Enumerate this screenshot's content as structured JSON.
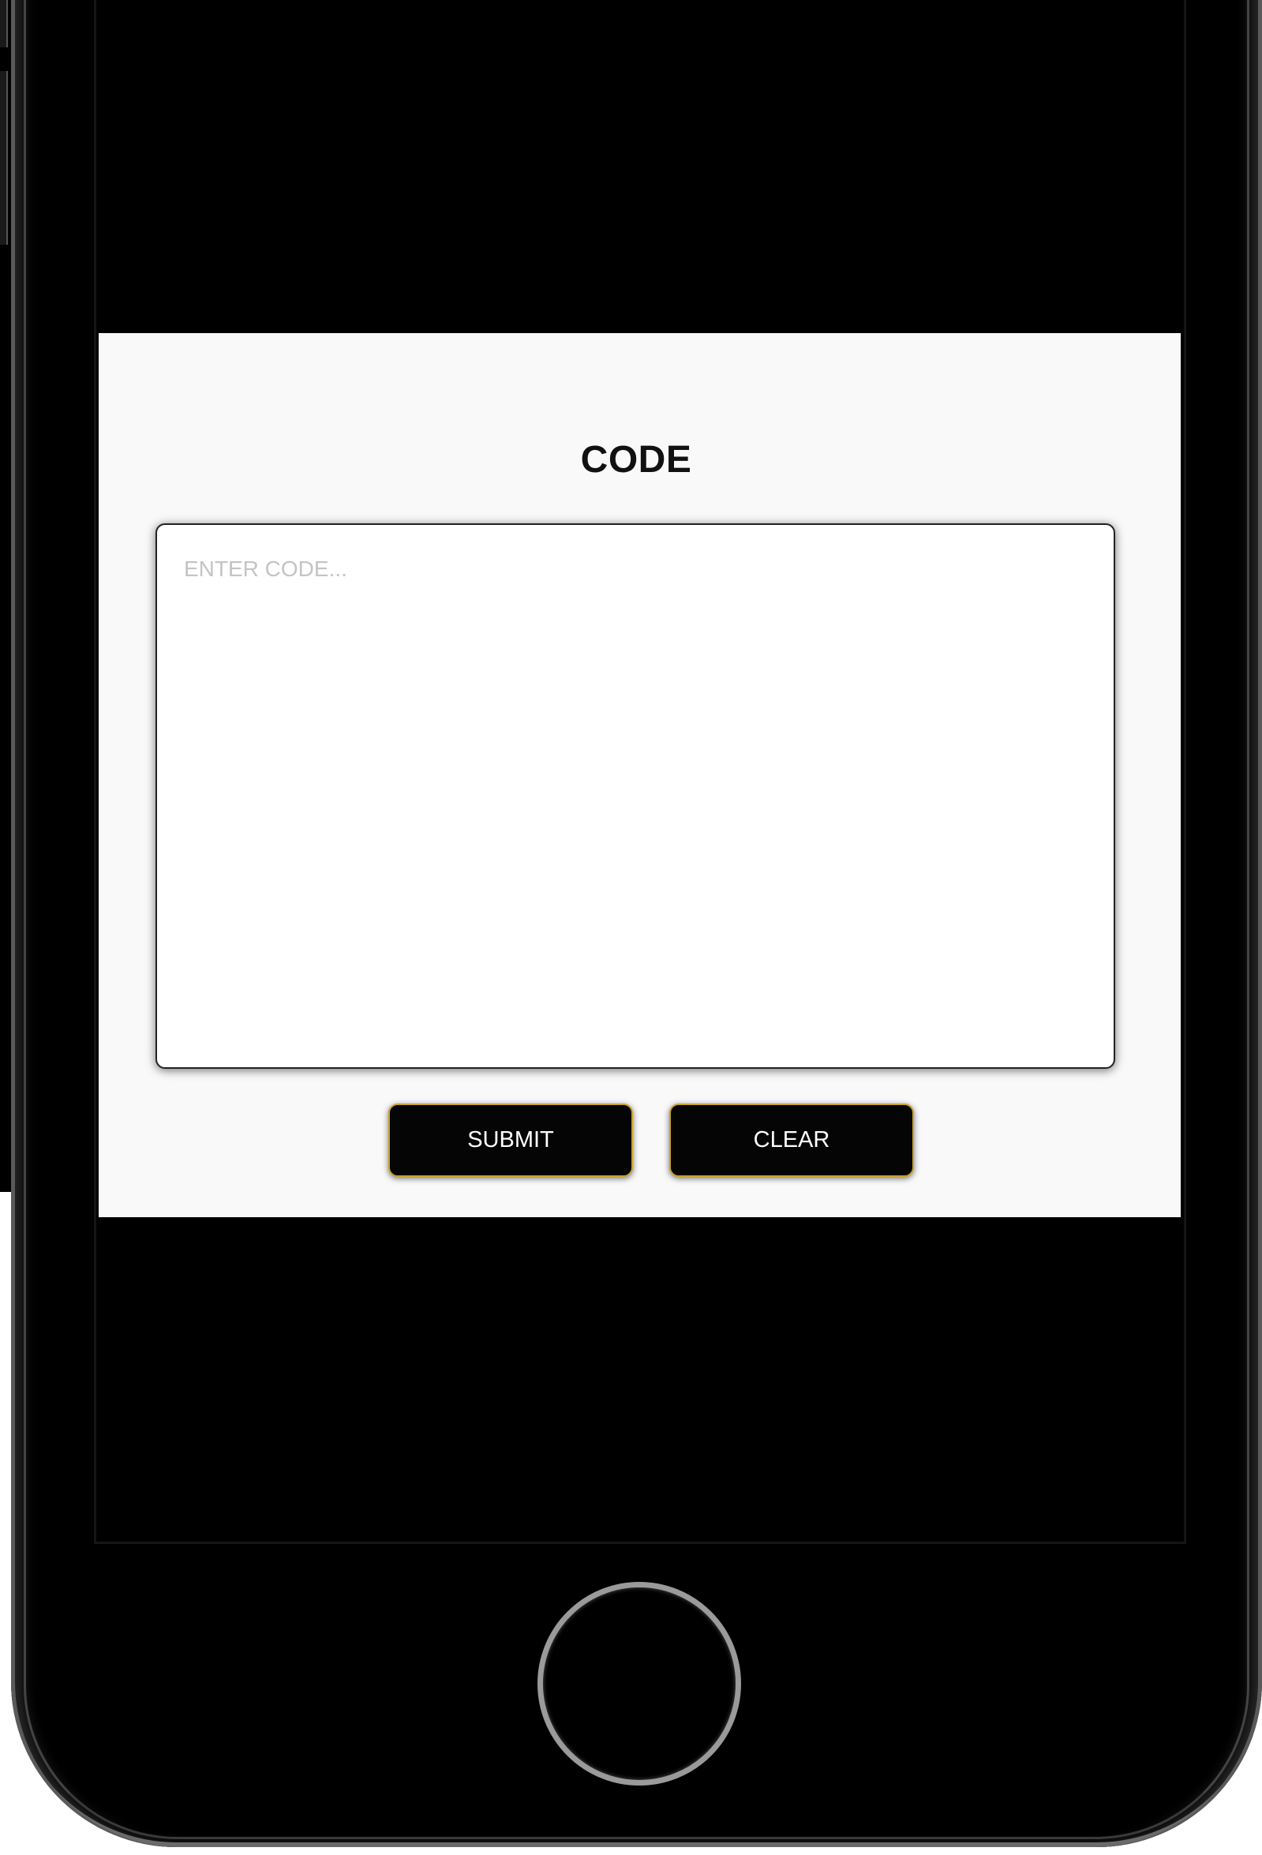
{
  "app": {
    "title": "CODE"
  },
  "code_input": {
    "value": "",
    "placeholder": "ENTER CODE..."
  },
  "buttons": {
    "submit_label": "SUBMIT",
    "clear_label": "CLEAR"
  },
  "colors": {
    "panel_background": "#f9f9f9",
    "button_background": "#050505",
    "button_border_accent": "#c9a227",
    "screen_background": "#000000"
  },
  "icons": {
    "home": "home-button-ring"
  }
}
